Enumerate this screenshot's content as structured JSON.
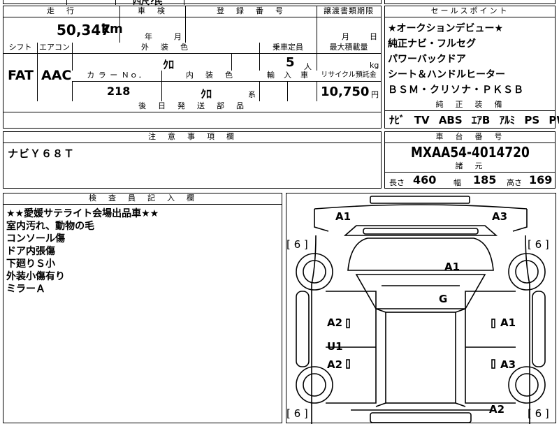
{
  "top_partial": {
    "text": "四尺?民"
  },
  "mileage": {
    "header": "走　行",
    "value": "50,347",
    "unit": "km"
  },
  "shaken": {
    "header": "車　検",
    "year_unit": "年",
    "month_unit": "月"
  },
  "registration": {
    "header": "登　録　番　号"
  },
  "transfer": {
    "header": "譲渡書類期限",
    "month_unit": "月",
    "day_unit": "日"
  },
  "shift": {
    "header": "シフト",
    "value": "FAT"
  },
  "aircon": {
    "header": "エアコン",
    "value": "AAC"
  },
  "exterior_color": {
    "header": "外　装　色",
    "value": "ｸﾛ"
  },
  "capacity": {
    "header": "乗車定員",
    "value": "5",
    "unit": "人"
  },
  "max_load": {
    "header": "最大積載量",
    "unit": "kg"
  },
  "color_no": {
    "header": "カ ラ ー Ｎｏ．",
    "value": "218"
  },
  "interior_color": {
    "header": "内　装　色",
    "value": "ｸﾛ",
    "suffix": "系"
  },
  "import": {
    "header": "輸　入　車"
  },
  "recycle": {
    "header": "リサイクル預託金",
    "value": "10,750",
    "unit": "円"
  },
  "later_parts": {
    "header": "後　日　発　送　部　品"
  },
  "sales_points": {
    "header": "セールスポイント",
    "items": [
      "★オークションデビュー★",
      "純正ナビ・フルセグ",
      "パワーバックドア",
      "シート＆ハンドルヒーター",
      "ＢＳＭ・クリソナ・ＰＫＳＢ"
    ]
  },
  "factory_equipment": {
    "header": "純　正　装　備",
    "items": [
      "ﾅﾋﾞ",
      "TV",
      "ABS",
      "ｴｱB",
      "ｱﾙﾐ",
      "PS",
      "PW"
    ]
  },
  "notes": {
    "header": "注　意　事　項　欄",
    "text": "ナビＹ６８Ｔ"
  },
  "chassis": {
    "header": "車　台　番　号",
    "value": "MXAA54-4014720"
  },
  "specs": {
    "header": "諸　元",
    "length_label": "長さ",
    "length": "460",
    "width_label": "幅",
    "width": "185",
    "height_label": "高さ",
    "height": "169"
  },
  "inspector": {
    "header": "検　査　員　記　入　欄",
    "lines": [
      "★★愛媛サテライト会場出品車★★",
      "室内汚れ、動物の毛",
      "コンソール傷",
      "ドア内張傷",
      "下廻りＳ小",
      "外装小傷有り",
      "ミラーＡ"
    ]
  },
  "diagram": {
    "marks": {
      "front_left": "A1",
      "front_right": "A3",
      "hood": "A1",
      "windshield": "G",
      "front_door_left": "A2",
      "front_door_right": "A1",
      "rear_door_left_1": "U1",
      "rear_door_left_2": "A2",
      "rear_door_right": "A3",
      "rear_right": "A2"
    },
    "tires": {
      "front_left": "[ 6 ]",
      "front_right": "[ 6 ]",
      "rear_left": "[ 6 ]",
      "rear_right": "[ 6 ]"
    }
  }
}
